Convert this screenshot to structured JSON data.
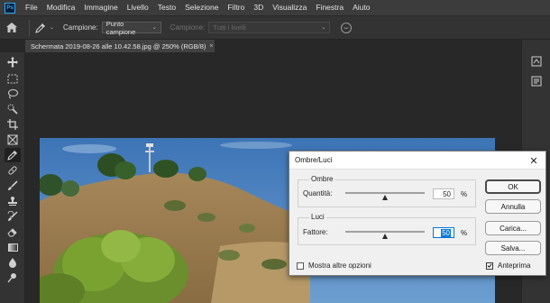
{
  "app": {
    "logo_text": "Ps"
  },
  "menu": [
    "File",
    "Modifica",
    "Immagine",
    "Livello",
    "Testo",
    "Selezione",
    "Filtro",
    "3D",
    "Visualizza",
    "Finestra",
    "Aiuto"
  ],
  "options": {
    "sample_label": "Campione:",
    "sample_value": "Punto campione",
    "sample2_label": "Campione:",
    "sample2_value": "Tutti i livelli"
  },
  "document": {
    "tab_title": "Schermata 2019-08-26 alle 10.42.58.jpg @ 250% (RGB/8)",
    "tab_close": "×"
  },
  "dialog": {
    "title": "Ombre/Luci",
    "close": "✕",
    "shadows": {
      "title": "Ombre",
      "label": "Quantità:",
      "value": "50",
      "unit": "%",
      "level": 0.5
    },
    "highlights": {
      "title": "Luci",
      "label": "Fattore:",
      "value": "50",
      "unit": "%",
      "level": 0.5
    },
    "more_options": {
      "label": "Mostra altre opzioni",
      "checked": false
    },
    "preview": {
      "label": "Anteprima",
      "checked": true
    },
    "buttons": {
      "ok": "OK",
      "cancel": "Annulla",
      "load": "Carica...",
      "save": "Salva..."
    }
  },
  "colors": {
    "accent": "#31a8ff",
    "focus": "#0078d7",
    "sky": "#3f78b8"
  },
  "icons": {
    "tools": [
      "move-icon",
      "marquee-icon",
      "lasso-icon",
      "quick-select-icon",
      "crop-icon",
      "frame-icon",
      "eyedropper-icon",
      "healing-brush-icon",
      "brush-icon",
      "clone-stamp-icon",
      "history-brush-icon",
      "eraser-icon",
      "gradient-icon",
      "blur-icon",
      "dodge-icon"
    ],
    "panels": [
      "history-panel-icon",
      "properties-panel-icon"
    ]
  }
}
